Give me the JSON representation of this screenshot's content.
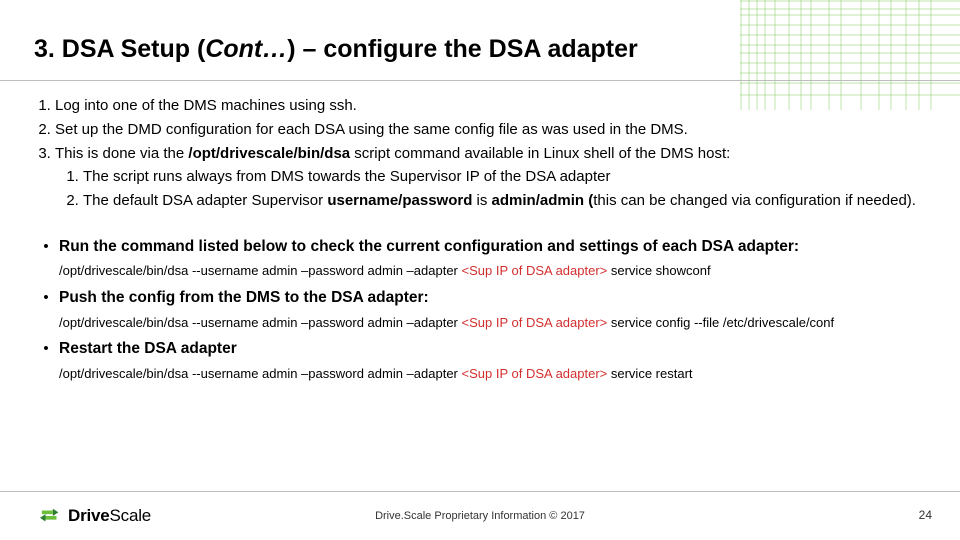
{
  "title": {
    "prefix": "3. DSA Setup (",
    "italic": "Cont…",
    "suffix": ") – configure the DSA adapter"
  },
  "steps": {
    "s1": "Log into one of the DMS machines using ssh.",
    "s2": "Set up the DMD configuration for each DSA using the same config file as was used in the DMS.",
    "s3_a": "This is done via the ",
    "s3_b": "/opt/drivescale/bin/dsa",
    "s3_c": " script command available in Linux shell of the DMS host:",
    "s3_1": "The script runs always from DMS towards the Supervisor IP of the DSA adapter",
    "s3_2_a": "The default DSA adapter Supervisor ",
    "s3_2_b": "username/password",
    "s3_2_c": " is ",
    "s3_2_d": "admin/admin (",
    "s3_2_e": "this can be changed via configuration if needed)."
  },
  "bullets": {
    "b1": "Run the command listed below to check the current configuration and settings of each DSA adapter:",
    "b2": "Push the config from the DMS to the DSA adapter:",
    "b3": "Restart the DSA adapter"
  },
  "cmds": {
    "c1a": "/opt/drivescale/bin/dsa --username admin –password admin –adapter ",
    "sup": "<Sup IP of DSA adapter>",
    "c1b": " service showconf",
    "c2a": "/opt/drivescale/bin/dsa --username admin –password admin –adapter ",
    "c2b": " service config --file /etc/drivescale/conf",
    "c3a": "/opt/drivescale/bin/dsa --username admin –password admin –adapter ",
    "c3b": " service restart"
  },
  "footer": {
    "brand_bold": "Drive",
    "brand_rest": "Scale",
    "copyright": "Drive.Scale Proprietary Information © 2017",
    "page": "24"
  }
}
